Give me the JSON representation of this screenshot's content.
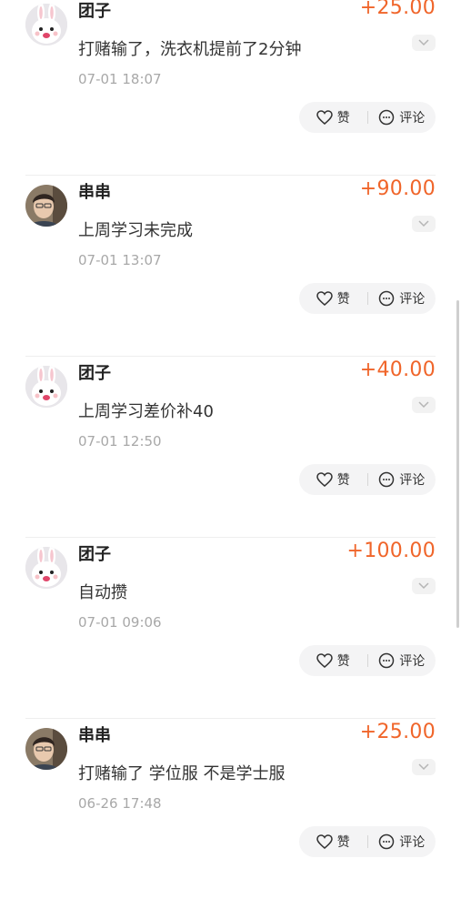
{
  "entries": [
    {
      "name": "团子",
      "avatar": "bunny",
      "amount": "+25.00",
      "desc": "打赌输了，洗衣机提前了2分钟",
      "time": "07-01 18:07",
      "like": "赞",
      "comment": "评论"
    },
    {
      "name": "串串",
      "avatar": "person",
      "amount": "+90.00",
      "desc": "上周学习未完成",
      "time": "07-01 13:07",
      "like": "赞",
      "comment": "评论"
    },
    {
      "name": "团子",
      "avatar": "bunny",
      "amount": "+40.00",
      "desc": "上周学习差价补40",
      "time": "07-01 12:50",
      "like": "赞",
      "comment": "评论"
    },
    {
      "name": "团子",
      "avatar": "bunny",
      "amount": "+100.00",
      "desc": "自动攒",
      "time": "07-01 09:06",
      "like": "赞",
      "comment": "评论"
    },
    {
      "name": "串串",
      "avatar": "person",
      "amount": "+25.00",
      "desc": "打赌输了 学位服 不是学士服",
      "time": "06-26 17:48",
      "like": "赞",
      "comment": "评论"
    }
  ],
  "colors": {
    "amount": "#f0652a",
    "time": "#a8a8a8"
  }
}
